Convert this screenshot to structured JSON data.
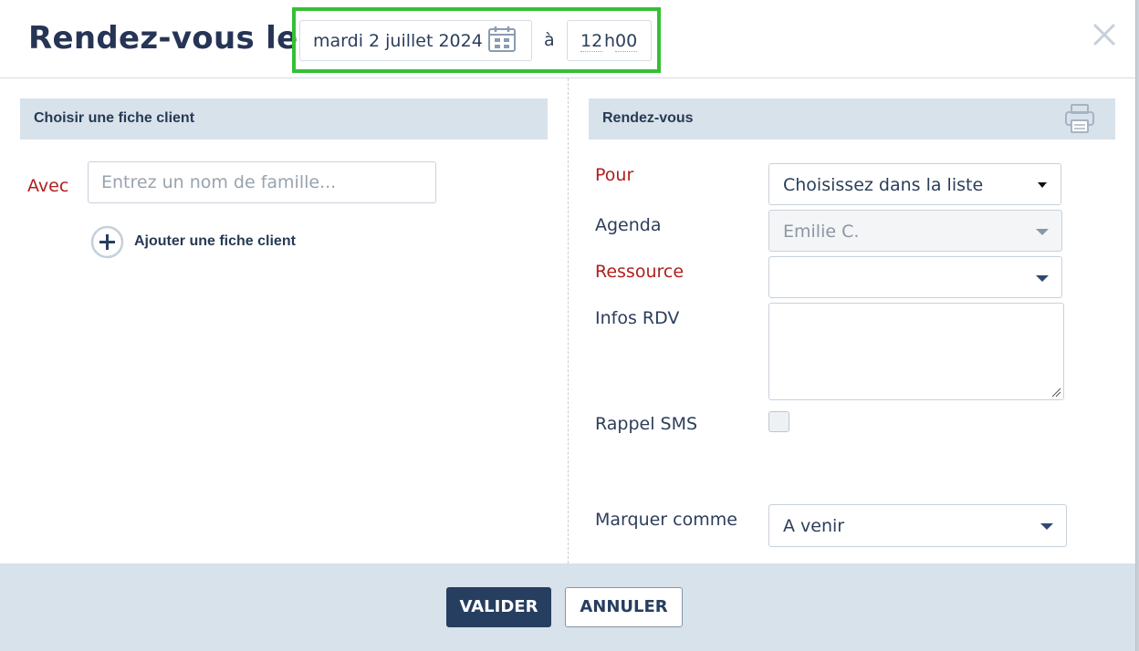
{
  "header": {
    "title": "Rendez-vous le",
    "date": "mardi 2 juillet 2024",
    "separator": "à",
    "time_hours": "12",
    "time_sep": "h",
    "time_minutes": "00"
  },
  "left_panel": {
    "heading": "Choisir une fiche client",
    "avec_label": "Avec",
    "name_placeholder": "Entrez un nom de famille...",
    "add_client_label": "Ajouter une fiche client"
  },
  "right_panel": {
    "heading": "Rendez-vous",
    "pour_label": "Pour",
    "pour_value": "Choisissez dans la liste",
    "agenda_label": "Agenda",
    "agenda_value": "Emilie C.",
    "ressource_label": "Ressource",
    "ressource_value": "",
    "infos_label": "Infos RDV",
    "infos_value": "",
    "sms_label": "Rappel SMS",
    "sms_checked": false,
    "marquer_label": "Marquer comme",
    "marquer_value": "A venir"
  },
  "footer": {
    "valider_label": "VALIDER",
    "annuler_label": "ANNULER"
  },
  "colors": {
    "primary": "#263e5f",
    "required": "#b01e1e",
    "section_bg": "#d8e2ea",
    "highlight": "#35c035"
  },
  "icons": [
    "calendar-icon",
    "close-icon",
    "print-icon",
    "plus-circle-icon",
    "chevron-down-icon"
  ]
}
